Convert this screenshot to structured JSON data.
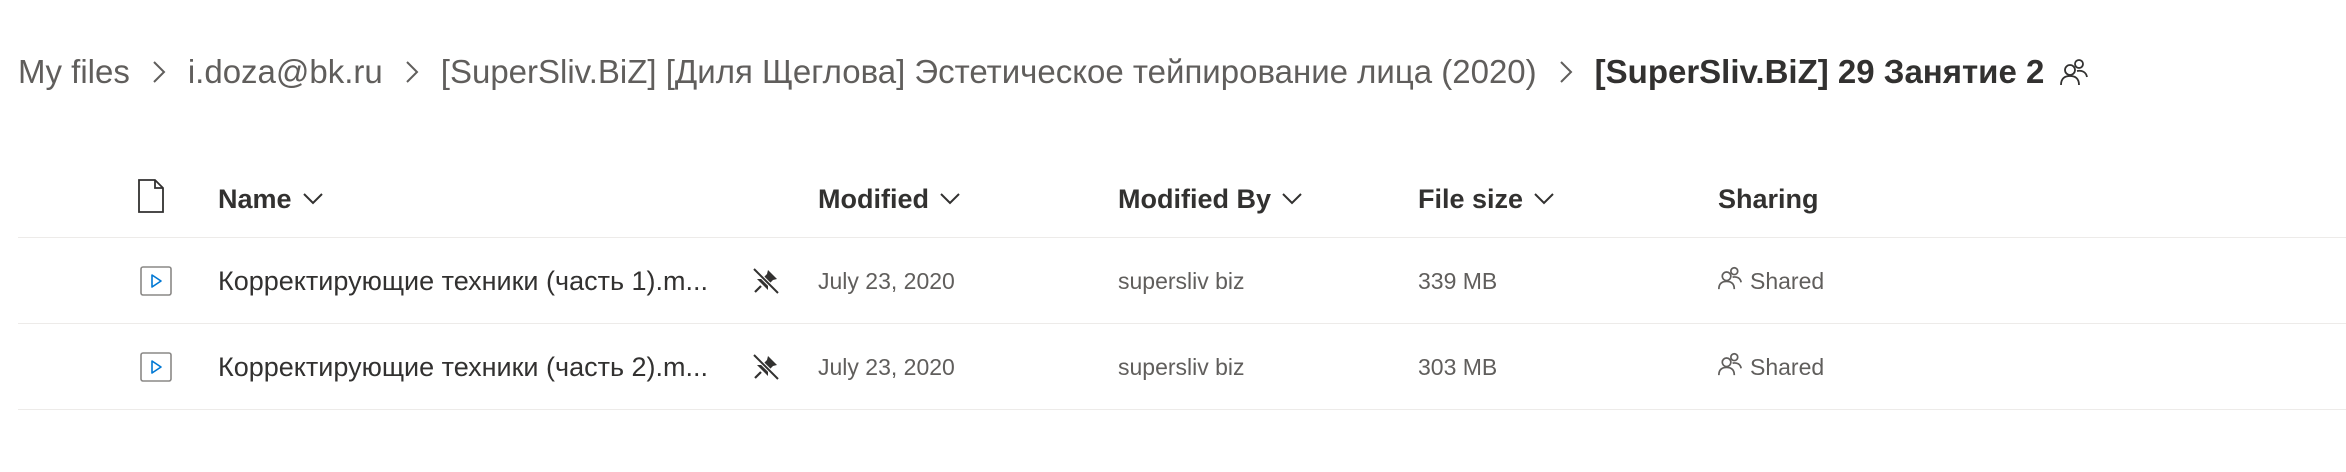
{
  "breadcrumb": {
    "items": [
      {
        "label": "My files"
      },
      {
        "label": "i.doza@bk.ru"
      },
      {
        "label": "[SuperSliv.BiZ] [Диля Щеглова] Эстетическое тейпирование лица (2020)"
      },
      {
        "label": "[SuperSliv.BiZ] 29 Занятие 2"
      }
    ]
  },
  "list": {
    "columns": {
      "name": "Name",
      "modified": "Modified",
      "modified_by": "Modified By",
      "file_size": "File size",
      "sharing": "Sharing"
    },
    "rows": [
      {
        "name": "Корректирующие техники (часть 1).m...",
        "modified": "July 23, 2020",
        "modified_by": "supersliv biz",
        "file_size": "339 MB",
        "sharing": "Shared"
      },
      {
        "name": "Корректирующие техники (часть 2).m...",
        "modified": "July 23, 2020",
        "modified_by": "supersliv biz",
        "file_size": "303 MB",
        "sharing": "Shared"
      }
    ]
  },
  "icons": {
    "breadcrumb_separator": "chevron-right-icon",
    "folder_shared": "people-icon",
    "file_type_header": "document-icon",
    "video_file": "video-file-icon",
    "pinned": "pin-off-icon",
    "sort": "chevron-down-icon",
    "shared": "people-icon"
  },
  "colors": {
    "text_primary": "#323130",
    "text_secondary": "#605e5c",
    "divider": "#edebe9",
    "video_icon_accent": "#0078d4"
  }
}
